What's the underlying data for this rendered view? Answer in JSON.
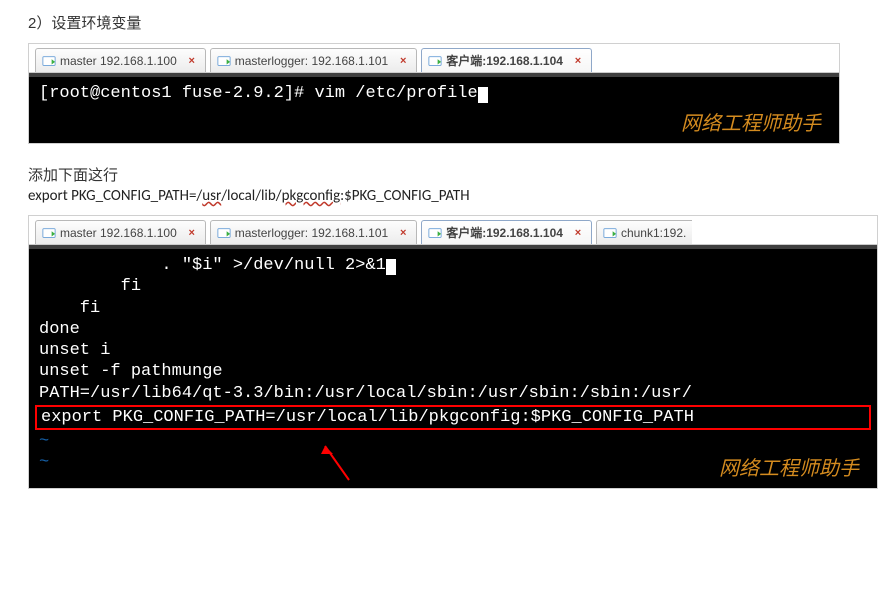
{
  "heading_1": "2）设置环境变量",
  "term1": {
    "tabs": [
      {
        "label": "master 192.168.1.100"
      },
      {
        "label": "masterlogger: 192.168.1.101"
      },
      {
        "label": "客户端:192.168.1.104",
        "active": true
      }
    ],
    "prompt_line": "[root@centos1 fuse-2.9.2]# vim /etc/profile",
    "watermark": "网络工程师助手"
  },
  "heading_2": "添加下面这行",
  "code_line": {
    "prefix": "export   PKG_CONFIG_PATH=/",
    "u1": "usr",
    "m1": "/local/lib/",
    "u2": "pkgconfig",
    "suffix": ":$PKG_CONFIG_PATH"
  },
  "term2": {
    "tabs": [
      {
        "label": "master 192.168.1.100"
      },
      {
        "label": "masterlogger: 192.168.1.101"
      },
      {
        "label": "客户端:192.168.1.104",
        "active": true
      },
      {
        "label": "chunk1:192."
      }
    ],
    "lines": {
      "l1": "            . \"$i\" >/dev/null 2>&1",
      "l2": "        fi",
      "l3": "    fi",
      "l4": "done",
      "l5": "",
      "l6": "unset i",
      "l7": "unset -f pathmunge",
      "l8": "PATH=/usr/lib64/qt-3.3/bin:/usr/local/sbin:/usr/sbin:/sbin:/usr/",
      "l9": "export PKG_CONFIG_PATH=/usr/local/lib/pkgconfig:$PKG_CONFIG_PATH",
      "t1": "~",
      "t2": "~"
    },
    "watermark": "网络工程师助手"
  }
}
